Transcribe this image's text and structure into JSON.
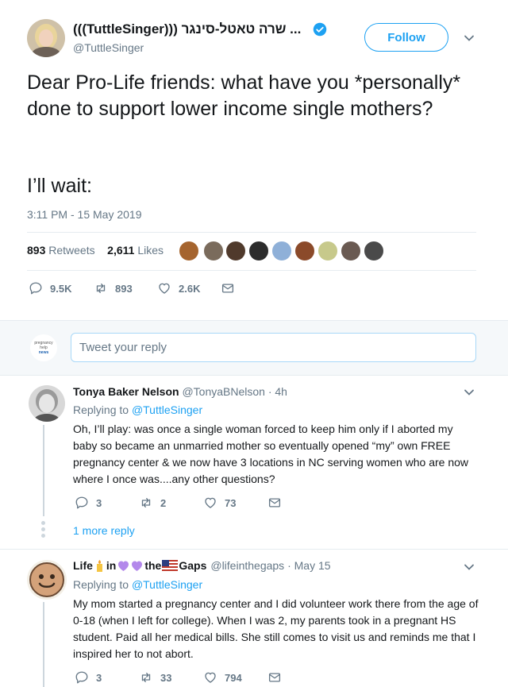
{
  "tweet": {
    "display_name": "(((TuttleSinger))) שרה טאטל-סינגר ...",
    "handle": "@TuttleSinger",
    "follow_label": "Follow",
    "text_line1": "Dear Pro-Life friends: what have you *personally* done to support lower income single mothers?",
    "text_line2": "I’ll wait:",
    "timestamp": "3:11 PM - 15 May 2019",
    "retweets_count": "893",
    "retweets_label": "Retweets",
    "likes_count": "2,611",
    "likes_label": "Likes",
    "actions": {
      "replies": "9.5K",
      "retweets": "893",
      "likes": "2.6K"
    }
  },
  "reply_box": {
    "placeholder": "Tweet your reply",
    "avatar_text": [
      "pregnancy",
      "help",
      "news"
    ]
  },
  "replies": [
    {
      "name": "Tonya Baker Nelson",
      "handle_time": "@TonyaBNelson · 4h",
      "replying_prefix": "Replying to",
      "replying_to": "@TuttleSinger",
      "body": "Oh, I’ll play: was once a single woman forced to keep him only if I aborted my baby so became an unmarried mother so eventually opened “my” own FREE pregnancy center & we now have 3 locations in NC serving women who are now where I once was....any other questions?",
      "replies": "3",
      "retweets": "2",
      "likes": "73",
      "more_label": "1 more reply"
    },
    {
      "name_parts": [
        "Life",
        "in",
        "the",
        "Gaps"
      ],
      "handle_time": "@lifeinthegaps · May 15",
      "replying_prefix": "Replying to",
      "replying_to": "@TuttleSinger",
      "body": "My mom started a pregnancy center and I did volunteer work there from the age of 0-18 (when I left for college). When I was 2, my parents took in a pregnant HS student. Paid all her medical bills. She still comes to visit us and reminds me that I inspired her to not abort.",
      "replies": "3",
      "retweets": "33",
      "likes": "794"
    }
  ],
  "colors": {
    "accent": "#1da1f2",
    "muted": "#657786",
    "divider": "#e6ecf0",
    "verified": "#1da1f2",
    "heart_emoji": "#b388eb"
  }
}
